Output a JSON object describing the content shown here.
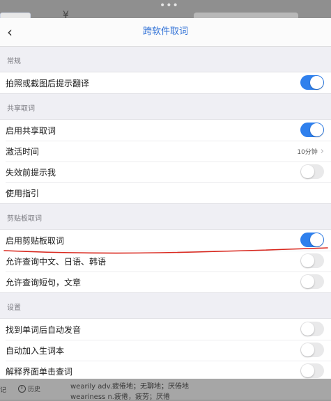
{
  "navbar": {
    "back_glyph": "‹",
    "title": "跨软件取词"
  },
  "sections": [
    {
      "header": "常规",
      "rows": [
        {
          "label": "拍照或截图后提示翻译",
          "type": "toggle",
          "on": true
        }
      ]
    },
    {
      "header": "共享取词",
      "rows": [
        {
          "label": "启用共享取词",
          "type": "toggle",
          "on": true
        },
        {
          "label": "激活时间",
          "type": "value",
          "value": "10分钟"
        },
        {
          "label": "失效前提示我",
          "type": "toggle",
          "on": false
        },
        {
          "label": "使用指引",
          "type": "plain"
        }
      ]
    },
    {
      "header": "剪贴板取词",
      "rows": [
        {
          "label": "启用剪贴板取词",
          "type": "toggle",
          "on": true
        },
        {
          "label": "允许查询中文、日语、韩语",
          "type": "toggle",
          "on": false
        },
        {
          "label": "允许查询短句，文章",
          "type": "toggle",
          "on": false
        }
      ]
    },
    {
      "header": "设置",
      "rows": [
        {
          "label": "找到单词后自动发音",
          "type": "toggle",
          "on": false
        },
        {
          "label": "自动加入生词本",
          "type": "toggle",
          "on": false
        },
        {
          "label": "解释界面单击查词",
          "type": "toggle",
          "on": false
        }
      ]
    }
  ],
  "bottom": {
    "left_text": "记",
    "history_label": "历史",
    "def_line_1": "wearily adv.疲倦地；无聊地；厌倦地",
    "def_line_2": "weariness n.疲倦，疲劳；厌倦"
  },
  "colors": {
    "accent": "#2f80ed",
    "annotation": "#d9261c"
  }
}
